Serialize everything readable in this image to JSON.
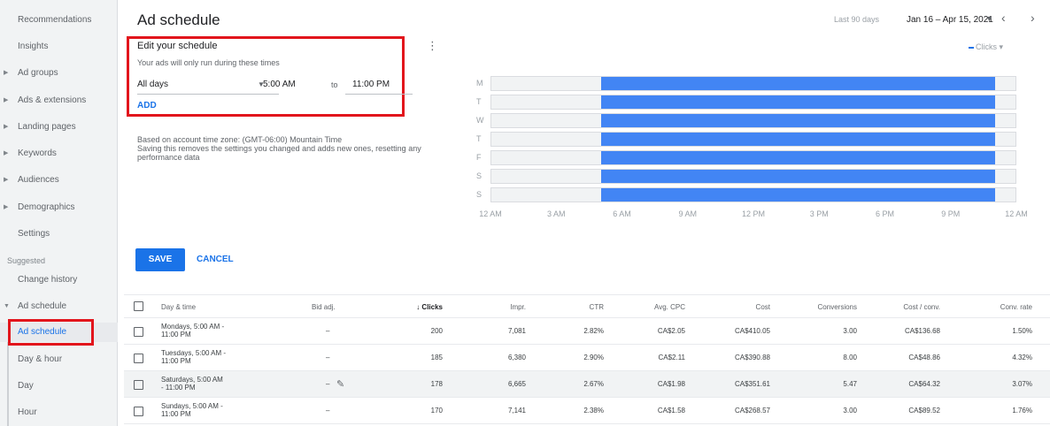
{
  "sidebar": {
    "items": [
      {
        "label": "Recommendations",
        "caret": false
      },
      {
        "label": "Insights",
        "caret": false
      },
      {
        "label": "Ad groups",
        "caret": true
      },
      {
        "label": "Ads & extensions",
        "caret": true
      },
      {
        "label": "Landing pages",
        "caret": true
      },
      {
        "label": "Keywords",
        "caret": true
      },
      {
        "label": "Audiences",
        "caret": true
      },
      {
        "label": "Demographics",
        "caret": true
      },
      {
        "label": "Settings",
        "caret": false
      }
    ],
    "suggested_label": "Suggested",
    "change_history": "Change history",
    "ad_schedule_group": "Ad schedule",
    "sub_items": [
      "Ad schedule",
      "Day & hour",
      "Day",
      "Hour"
    ]
  },
  "header": {
    "title": "Ad schedule",
    "date_prefix": "Last 90 days",
    "date_range": "Jan 16 – Apr 15, 2021"
  },
  "schedule": {
    "title": "Edit your schedule",
    "subtitle": "Your ads will only run during these times",
    "days": "All days",
    "start": "5:00 AM",
    "to": "to",
    "end": "11:00 PM",
    "add": "ADD",
    "timezone_note": "Based on account time zone: (GMT-06:00) Mountain Time\nSaving this removes the settings you changed and adds new ones, resetting any performance data"
  },
  "chart_data": {
    "type": "heatmap",
    "metric": "Clicks",
    "days": [
      "M",
      "T",
      "W",
      "T",
      "F",
      "S",
      "S"
    ],
    "hour_labels": [
      "12 AM",
      "3 AM",
      "6 AM",
      "9 AM",
      "12 PM",
      "3 PM",
      "6 PM",
      "9 PM",
      "12 AM"
    ],
    "active_start_hour": 5,
    "active_end_hour": 23,
    "fill_color": "#4285f4"
  },
  "actions": {
    "save": "SAVE",
    "cancel": "CANCEL"
  },
  "table": {
    "headers": [
      "Day & time",
      "Bid adj.",
      "Clicks",
      "Impr.",
      "CTR",
      "Avg. CPC",
      "Cost",
      "Conversions",
      "Cost / conv.",
      "Conv. rate"
    ],
    "rows": [
      {
        "day": "Mondays, 5:00 AM -",
        "time": "11:00 PM",
        "bid": "–",
        "clicks": "200",
        "impr": "7,081",
        "ctr": "2.82%",
        "cpc": "CA$2.05",
        "cost": "CA$410.05",
        "conv": "3.00",
        "cpconv": "CA$136.68",
        "rate": "1.50%"
      },
      {
        "day": "Tuesdays, 5:00 AM -",
        "time": "11:00 PM",
        "bid": "–",
        "clicks": "185",
        "impr": "6,380",
        "ctr": "2.90%",
        "cpc": "CA$2.11",
        "cost": "CA$390.88",
        "conv": "8.00",
        "cpconv": "CA$48.86",
        "rate": "4.32%"
      },
      {
        "day": "Saturdays, 5:00 AM",
        "time": "- 11:00 PM",
        "bid": "–",
        "clicks": "178",
        "impr": "6,665",
        "ctr": "2.67%",
        "cpc": "CA$1.98",
        "cost": "CA$351.61",
        "conv": "5.47",
        "cpconv": "CA$64.32",
        "rate": "3.07%"
      },
      {
        "day": "Sundays, 5:00 AM -",
        "time": "11:00 PM",
        "bid": "–",
        "clicks": "170",
        "impr": "7,141",
        "ctr": "2.38%",
        "cpc": "CA$1.58",
        "cost": "CA$268.57",
        "conv": "3.00",
        "cpconv": "CA$89.52",
        "rate": "1.76%"
      }
    ]
  }
}
